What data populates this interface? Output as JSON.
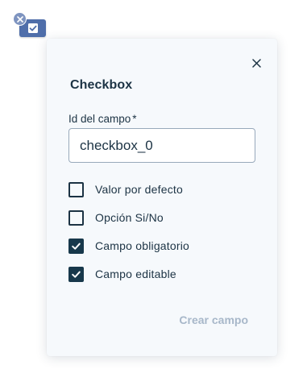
{
  "marker": {
    "icon": "checkbox-icon",
    "remove_icon": "close-icon"
  },
  "panel": {
    "title": "Checkbox",
    "close_icon": "close-icon",
    "id_field": {
      "label": "Id del campo",
      "required_mark": "*",
      "value": "checkbox_0"
    },
    "options": [
      {
        "label": "Valor por defecto",
        "checked": false
      },
      {
        "label": "Opción Si/No",
        "checked": false
      },
      {
        "label": "Campo obligatorio",
        "checked": true
      },
      {
        "label": "Campo editable",
        "checked": true
      }
    ],
    "submit_label": "Crear campo"
  },
  "colors": {
    "marker_bg": "#4f6eaa",
    "marker_remove_bg": "#7e94c0",
    "panel_bg": "#f6f9fc",
    "text": "#1c3344",
    "checkbox_checked": "#17384b",
    "submit_disabled": "#a7b7c9"
  }
}
